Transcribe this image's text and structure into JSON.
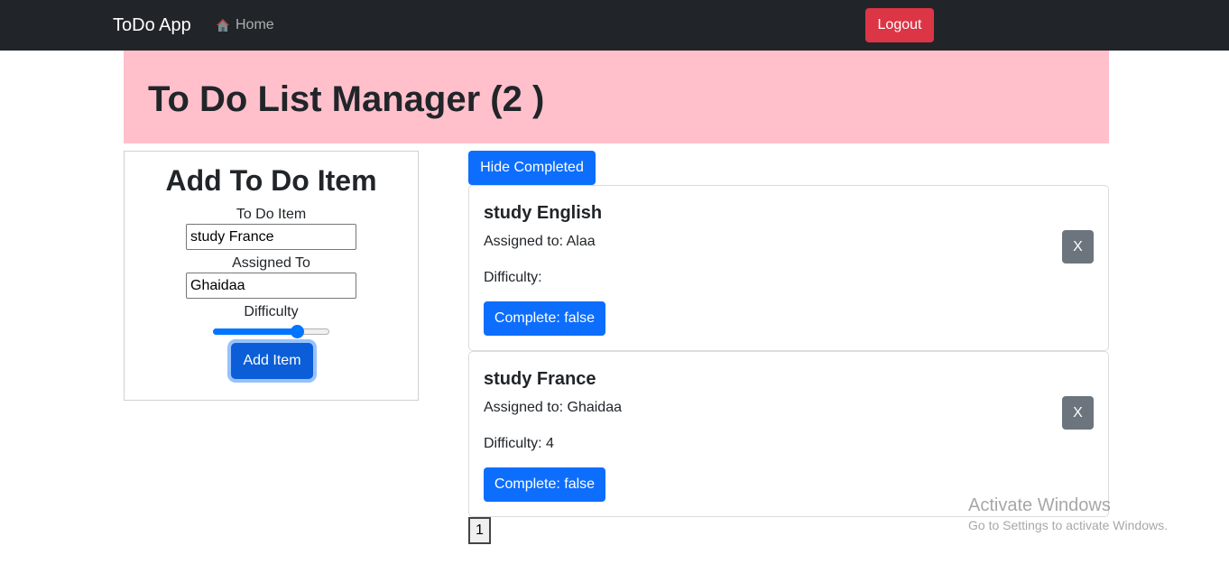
{
  "navbar": {
    "brand": "ToDo App",
    "home_label": "Home",
    "home_icon": "home-icon",
    "logout_label": "Logout"
  },
  "header": {
    "title": "To Do List Manager (2 )"
  },
  "add_form": {
    "title": "Add To Do Item",
    "item_label": "To Do Item",
    "item_value": "study France",
    "assigned_label": "Assigned To",
    "assigned_value": "Ghaidaa",
    "difficulty_label": "Difficulty",
    "difficulty_value": 4,
    "difficulty_min": 1,
    "difficulty_max": 5,
    "submit_label": "Add Item"
  },
  "list": {
    "hide_completed_label": "Hide Completed",
    "items": [
      {
        "title": "study English",
        "assigned": "Assigned to: Alaa",
        "difficulty": "Difficulty:",
        "complete_label": "Complete: false",
        "delete_label": "X"
      },
      {
        "title": "study France",
        "assigned": "Assigned to: Ghaidaa",
        "difficulty": "Difficulty: 4",
        "complete_label": "Complete: false",
        "delete_label": "X"
      }
    ]
  },
  "pagination": {
    "page_1": "1"
  },
  "watermark": {
    "title": "Activate Windows",
    "subtitle": "Go to Settings to activate Windows."
  },
  "colors": {
    "navbar_bg": "#212529",
    "banner_bg": "#ffc0cb",
    "primary": "#0d6efd",
    "danger": "#dc3545",
    "secondary": "#6c757d"
  }
}
